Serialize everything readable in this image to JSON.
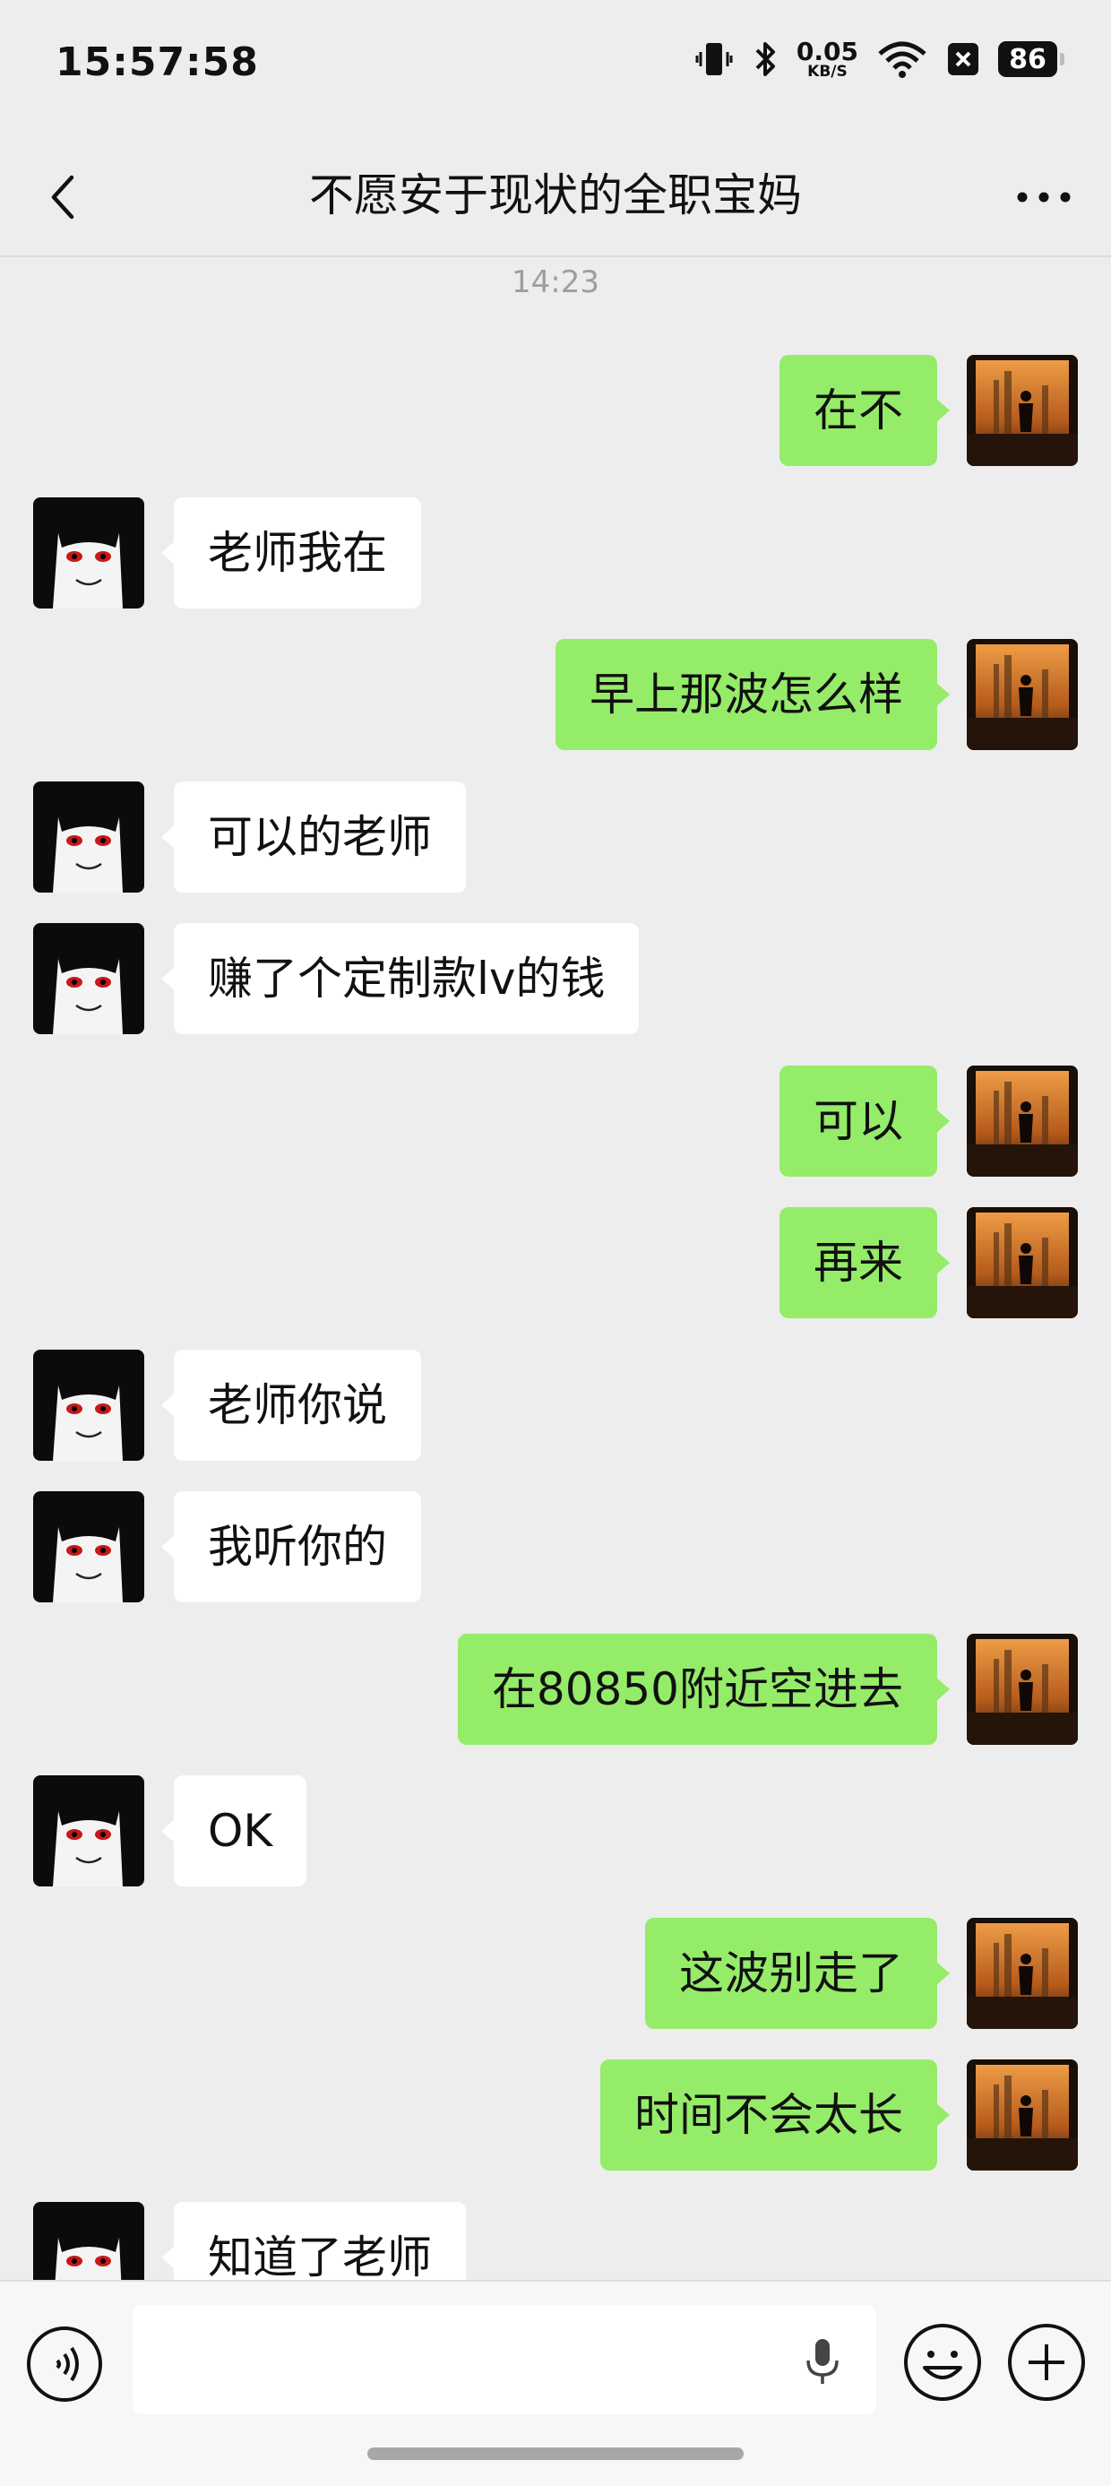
{
  "status_bar": {
    "time": "15:57:58",
    "net_speed_value": "0.05",
    "net_speed_unit": "KB/S",
    "battery": "86",
    "icons": [
      "vibrate-icon",
      "bluetooth-icon",
      "wifi-icon",
      "close-app-icon"
    ]
  },
  "nav": {
    "title": "不愿安于现状的全职宝妈",
    "back_icon": "chevron-left-icon",
    "more_icon": "more-dots-icon"
  },
  "chat": {
    "timestamp": "14:23",
    "messages": [
      {
        "from": "me",
        "text": "在不"
      },
      {
        "from": "other",
        "text": "老师我在"
      },
      {
        "from": "me",
        "text": "早上那波怎么样"
      },
      {
        "from": "other",
        "text": "可以的老师"
      },
      {
        "from": "other",
        "text": "赚了个定制款lv的钱"
      },
      {
        "from": "me",
        "text": "可以"
      },
      {
        "from": "me",
        "text": "再来"
      },
      {
        "from": "other",
        "text": "老师你说"
      },
      {
        "from": "other",
        "text": "我听你的"
      },
      {
        "from": "me",
        "text": "在80850附近空进去"
      },
      {
        "from": "other",
        "text": "OK"
      },
      {
        "from": "me",
        "text": "这波别走了"
      },
      {
        "from": "me",
        "text": "时间不会太长"
      },
      {
        "from": "other",
        "text": "知道了老师"
      }
    ]
  },
  "input_bar": {
    "placeholder": "",
    "icons": [
      "voice-icon",
      "mic-icon",
      "emoji-icon",
      "plus-icon"
    ]
  },
  "colors": {
    "background": "#ededed",
    "outgoing_bubble": "#95ec69",
    "incoming_bubble": "#ffffff"
  }
}
